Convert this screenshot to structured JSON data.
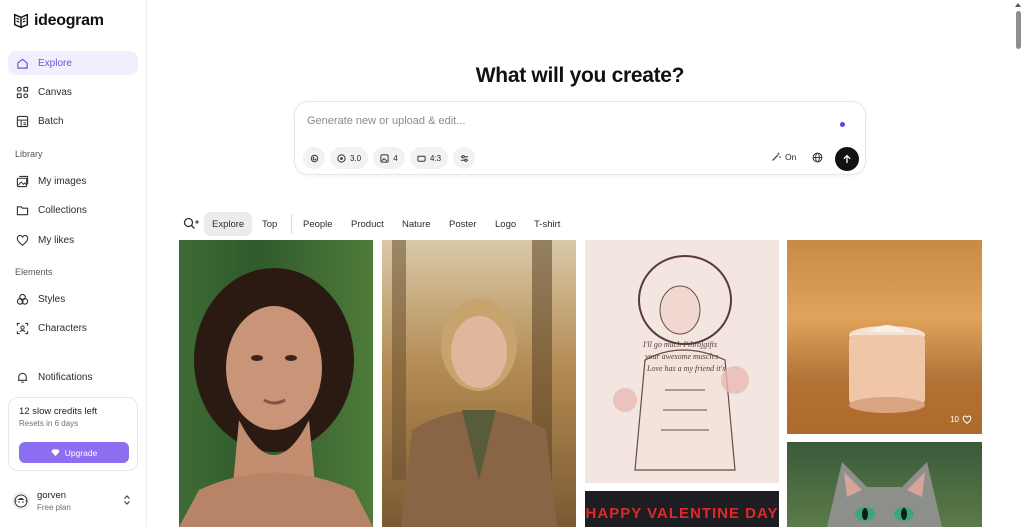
{
  "brand": {
    "name": "ideogram"
  },
  "sidebar": {
    "nav": [
      {
        "label": "Explore",
        "icon": "home-icon"
      },
      {
        "label": "Canvas",
        "icon": "canvas-icon"
      },
      {
        "label": "Batch",
        "icon": "batch-icon"
      }
    ],
    "library_label": "Library",
    "library": [
      {
        "label": "My images",
        "icon": "images-icon"
      },
      {
        "label": "Collections",
        "icon": "folder-icon"
      },
      {
        "label": "My likes",
        "icon": "heart-icon"
      }
    ],
    "elements_label": "Elements",
    "elements": [
      {
        "label": "Styles",
        "icon": "styles-icon"
      },
      {
        "label": "Characters",
        "icon": "characters-icon"
      }
    ],
    "notifications": {
      "label": "Notifications",
      "icon": "bell-icon"
    },
    "credits": {
      "title": "12 slow credits left",
      "subtitle": "Resets in 6 days",
      "upgrade_label": "Upgrade"
    },
    "user": {
      "name": "gorven",
      "plan": "Free plan"
    }
  },
  "main": {
    "headline": "What will you create?",
    "prompt": {
      "placeholder": "Generate new or upload & edit...",
      "chips": [
        {
          "icon": "attach-icon",
          "label": ""
        },
        {
          "icon": "model-icon",
          "label": "3.0"
        },
        {
          "icon": "image-count-icon",
          "label": "4"
        },
        {
          "icon": "aspect-ratio-icon",
          "label": "4:3"
        },
        {
          "icon": "settings-sliders-icon",
          "label": ""
        }
      ],
      "magic_prompt_label": "On"
    },
    "filters": {
      "tabs": [
        "Explore",
        "Top",
        "People",
        "Product",
        "Nature",
        "Poster",
        "Logo",
        "T-shirt"
      ],
      "active": "Explore"
    },
    "gallery": {
      "corset_lines": [
        "I'll go much Pthrojgifts",
        "your awesome muscles",
        "Love has a my friend it's"
      ],
      "valentine_text": "HAPPY VALENTINE DAY",
      "product_likes": "10"
    }
  },
  "colors": {
    "accent": "#8b6ff0",
    "active_nav_bg": "#f1effd",
    "active_nav_text": "#6b54d6"
  }
}
